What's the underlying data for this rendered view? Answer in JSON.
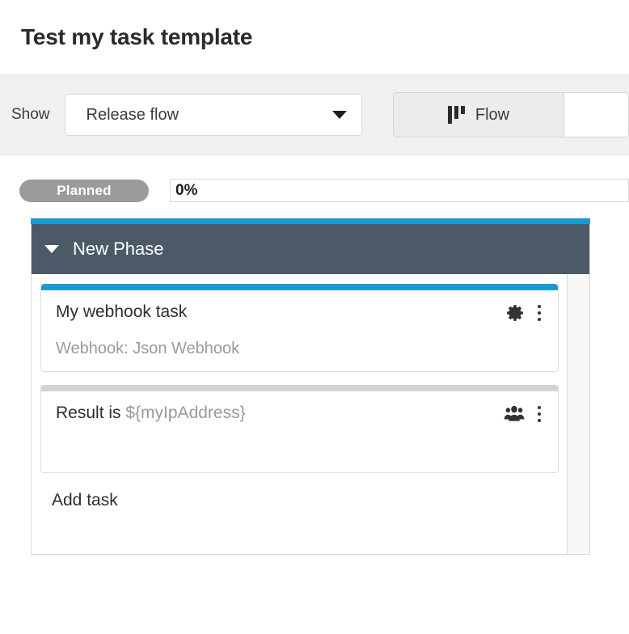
{
  "page": {
    "title": "Test my task template"
  },
  "toolbar": {
    "show_label": "Show",
    "flow_select": {
      "value": "Release flow",
      "caret_icon": "chevron-down-icon"
    },
    "view_toggle": [
      {
        "label": "Flow",
        "icon": "kanban-flow-icon",
        "active": true
      },
      {
        "label": "",
        "icon": "",
        "active": false
      }
    ]
  },
  "status": {
    "badge": "Planned",
    "badge_color": "#9b9b9b",
    "progress_text": "0%",
    "progress_percent": 0,
    "progress_color": "#1b9ad1"
  },
  "phase": {
    "accent_color": "#1b9ad1",
    "header_color": "#4c5a67",
    "title": "New Phase",
    "caret_icon": "caret-down-icon",
    "add_task_label": "Add task",
    "tasks": [
      {
        "title": "My webhook task",
        "title_variable": "",
        "subtitle": "Webhook: Json Webhook",
        "accent": "blue",
        "action_icon": "gear-icon",
        "menu_icon": "kebab-menu-icon"
      },
      {
        "title": "Result is ",
        "title_variable": "${myIpAddress}",
        "subtitle": "",
        "accent": "grey",
        "action_icon": "users-icon",
        "menu_icon": "kebab-menu-icon"
      }
    ]
  }
}
